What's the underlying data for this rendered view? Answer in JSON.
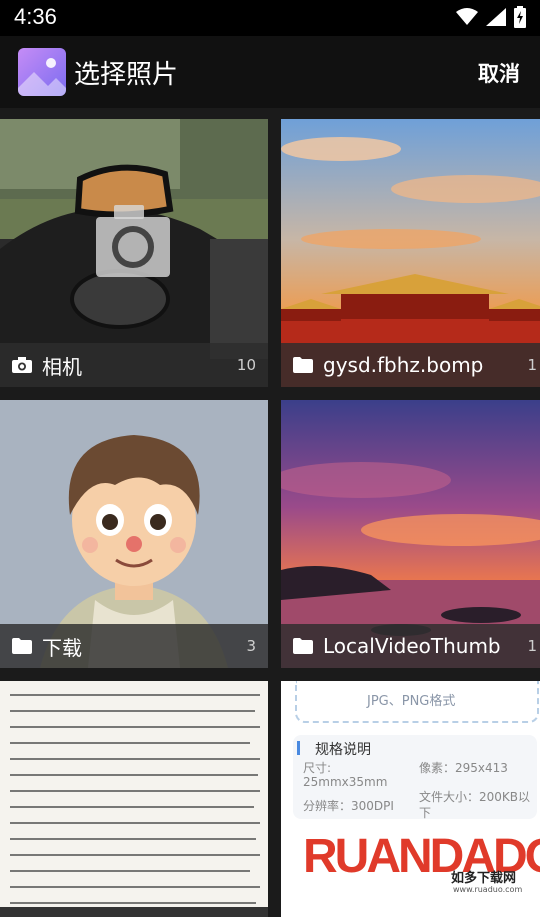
{
  "status_bar": {
    "time": "4:36"
  },
  "app_bar": {
    "title": "选择照片",
    "cancel_label": "取消"
  },
  "albums": [
    {
      "label": "相机",
      "count": "10",
      "icon": "camera-icon"
    },
    {
      "label": "gysd.fbhz.bomp",
      "count": "1",
      "icon": "folder-icon"
    },
    {
      "label": "下载",
      "count": "3",
      "icon": "folder-icon"
    },
    {
      "label": "LocalVideoThumb",
      "count": "1",
      "icon": "folder-icon"
    }
  ],
  "bottom_tiles": {
    "doc_heading": "规格说明",
    "doc_format": "JPG、PNG格式",
    "doc_size": "尺寸:",
    "doc_size_value": "25mmx35mm",
    "doc_pixels": "像素：295x413",
    "doc_dpi": "分辨率：300DPI",
    "doc_filesize": "文件大小：200KB以下",
    "watermark_brand": "RUANDADO",
    "watermark_cn": "如多下载网",
    "watermark_url": "www.ruaduo.com"
  }
}
